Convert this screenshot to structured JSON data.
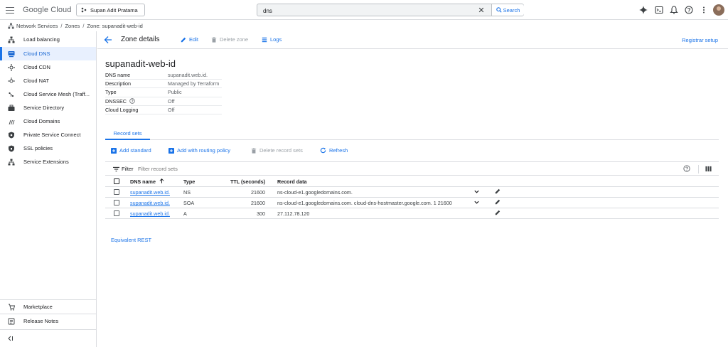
{
  "topbar": {
    "logo_google": "Google",
    "logo_cloud": "Cloud",
    "project": "Supan Adit Pratama",
    "search_value": "dns",
    "search_button": "Search"
  },
  "breadcrumb": {
    "root": "Network Services",
    "sep": "/",
    "zones": "Zones",
    "current": "Zone: supanadit-web-id"
  },
  "sidebar": {
    "items": [
      {
        "label": "Load balancing",
        "icon": "load-balancing-icon"
      },
      {
        "label": "Cloud DNS",
        "icon": "cloud-dns-icon",
        "active": true
      },
      {
        "label": "Cloud CDN",
        "icon": "cloud-cdn-icon"
      },
      {
        "label": "Cloud NAT",
        "icon": "cloud-nat-icon"
      },
      {
        "label": "Cloud Service Mesh (Traff...",
        "icon": "service-mesh-icon"
      },
      {
        "label": "Service Directory",
        "icon": "service-directory-icon"
      },
      {
        "label": "Cloud Domains",
        "icon": "cloud-domains-icon"
      },
      {
        "label": "Private Service Connect",
        "icon": "private-service-connect-icon"
      },
      {
        "label": "SSL policies",
        "icon": "ssl-policies-icon"
      },
      {
        "label": "Service Extensions",
        "icon": "service-extensions-icon"
      }
    ],
    "bottom": [
      {
        "label": "Marketplace",
        "icon": "marketplace-icon"
      },
      {
        "label": "Release Notes",
        "icon": "release-notes-icon"
      }
    ]
  },
  "header": {
    "title": "Zone details",
    "edit": "Edit",
    "delete_zone": "Delete zone",
    "logs": "Logs",
    "registrar_setup": "Registrar setup"
  },
  "zone": {
    "name": "supanadit-web-id",
    "details": [
      {
        "key": "DNS name",
        "value": "supanadit.web.id."
      },
      {
        "key": "Description",
        "value": "Managed by Terraform"
      },
      {
        "key": "Type",
        "value": "Public"
      },
      {
        "key": "DNSSEC",
        "value": "Off"
      },
      {
        "key": "Cloud Logging",
        "value": "Off"
      }
    ]
  },
  "tabs": {
    "record_sets": "Record sets"
  },
  "actions": {
    "add_standard": "Add standard",
    "add_routing": "Add with routing policy",
    "delete_record_sets": "Delete record sets",
    "refresh": "Refresh"
  },
  "filter": {
    "label": "Filter",
    "placeholder": "Filter record sets"
  },
  "table": {
    "headers": {
      "dns_name": "DNS name",
      "type": "Type",
      "ttl": "TTL (seconds)",
      "record_data": "Record data"
    },
    "rows": [
      {
        "dns_name": "supanadit.web.id.",
        "type": "NS",
        "ttl": "21600",
        "data": "ns-cloud-e1.googledomains.com."
      },
      {
        "dns_name": "supanadit.web.id.",
        "type": "SOA",
        "ttl": "21600",
        "data": "ns-cloud-e1.googledomains.com. cloud-dns-hostmaster.google.com. 1 21600"
      },
      {
        "dns_name": "supanadit.web.id.",
        "type": "A",
        "ttl": "300",
        "data": "27.112.78.120"
      }
    ]
  },
  "footer": {
    "equivalent_rest": "Equivalent REST"
  },
  "colors": {
    "accent": "#1a73e8",
    "active_bg": "#e8f0fe",
    "disabled": "#9aa0a6",
    "border": "#dadce0"
  }
}
